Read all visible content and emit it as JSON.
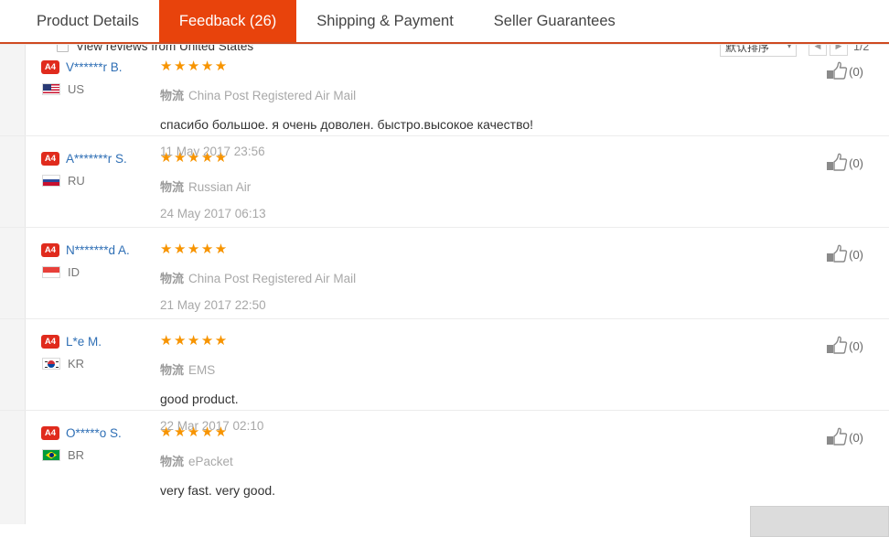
{
  "tabs": [
    {
      "label": "Product Details",
      "active": false
    },
    {
      "label": "Feedback (26)",
      "active": true
    },
    {
      "label": "Shipping & Payment",
      "active": false
    },
    {
      "label": "Seller Guarantees",
      "active": false
    }
  ],
  "filter": {
    "checkbox_label": "View reviews from United States",
    "checked": false
  },
  "sort": {
    "selected": "默认排序",
    "caret": "chevron-down-icon"
  },
  "pager": {
    "prev": "◀",
    "next": "▶",
    "count": "1/2"
  },
  "colors": {
    "active_tab": "#e8430c",
    "tab_border": "#cf4a20",
    "star": "#f79400",
    "username": "#2f6fb5",
    "badge": "#e02b1d",
    "muted": "#a8a8a8"
  },
  "shipping_prefix": "物流",
  "reviews": [
    {
      "badge": "A4",
      "name": "V******r B.",
      "country": "US",
      "flag": "us",
      "stars": "★★★★★",
      "shipping": "China Post Registered Air Mail",
      "comment": "спасибо большое. я очень доволен. быстро.высокое качество!",
      "date": "11 May 2017 23:56",
      "helpful": "(0)"
    },
    {
      "badge": "A4",
      "name": "A*******r S.",
      "country": "RU",
      "flag": "ru",
      "stars": "★★★★★",
      "shipping": "Russian Air",
      "comment": "",
      "date": "24 May 2017 06:13",
      "helpful": "(0)"
    },
    {
      "badge": "A4",
      "name": "N*******d A.",
      "country": "ID",
      "flag": "id",
      "stars": "★★★★★",
      "shipping": "China Post Registered Air Mail",
      "comment": "",
      "date": "21 May 2017 22:50",
      "helpful": "(0)"
    },
    {
      "badge": "A4",
      "name": "L*e M.",
      "country": "KR",
      "flag": "kr",
      "stars": "★★★★★",
      "shipping": "EMS",
      "comment": "good product.",
      "date": "22 Mar 2017 02:10",
      "helpful": "(0)"
    },
    {
      "badge": "A4",
      "name": "O*****o S.",
      "country": "BR",
      "flag": "br",
      "stars": "★★★★★",
      "shipping": "ePacket",
      "comment": "very fast. very good.",
      "date": "",
      "helpful": "(0)"
    }
  ]
}
